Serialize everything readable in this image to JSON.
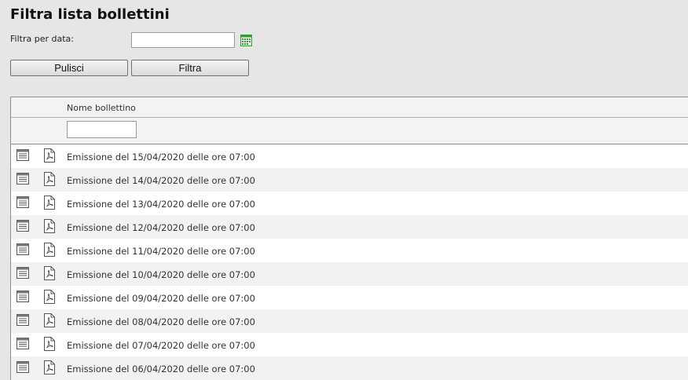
{
  "page": {
    "title": "Filtra lista bollettini",
    "filter_label": "Filtra per data:",
    "date_value": "",
    "clear_button": "Pulisci",
    "filter_button": "Filtra"
  },
  "grid": {
    "column_header": "Nome bollettino",
    "filter_value": "",
    "rows": [
      {
        "name": "Emissione del 15/04/2020 delle ore 07:00"
      },
      {
        "name": "Emissione del 14/04/2020 delle ore 07:00"
      },
      {
        "name": "Emissione del 13/04/2020 delle ore 07:00"
      },
      {
        "name": "Emissione del 12/04/2020 delle ore 07:00"
      },
      {
        "name": "Emissione del 11/04/2020 delle ore 07:00"
      },
      {
        "name": "Emissione del 10/04/2020 delle ore 07:00"
      },
      {
        "name": "Emissione del 09/04/2020 delle ore 07:00"
      },
      {
        "name": "Emissione del 08/04/2020 delle ore 07:00"
      },
      {
        "name": "Emissione del 07/04/2020 delle ore 07:00"
      },
      {
        "name": "Emissione del 06/04/2020 delle ore 07:00"
      }
    ]
  },
  "icons": {
    "calendar": "calendar-icon",
    "detail": "document-list-icon",
    "pdf": "pdf-icon"
  },
  "colors": {
    "background": "#e6e6e6",
    "row_alt": "#f2f2f2",
    "calendar_green": "#3a9a3a"
  }
}
